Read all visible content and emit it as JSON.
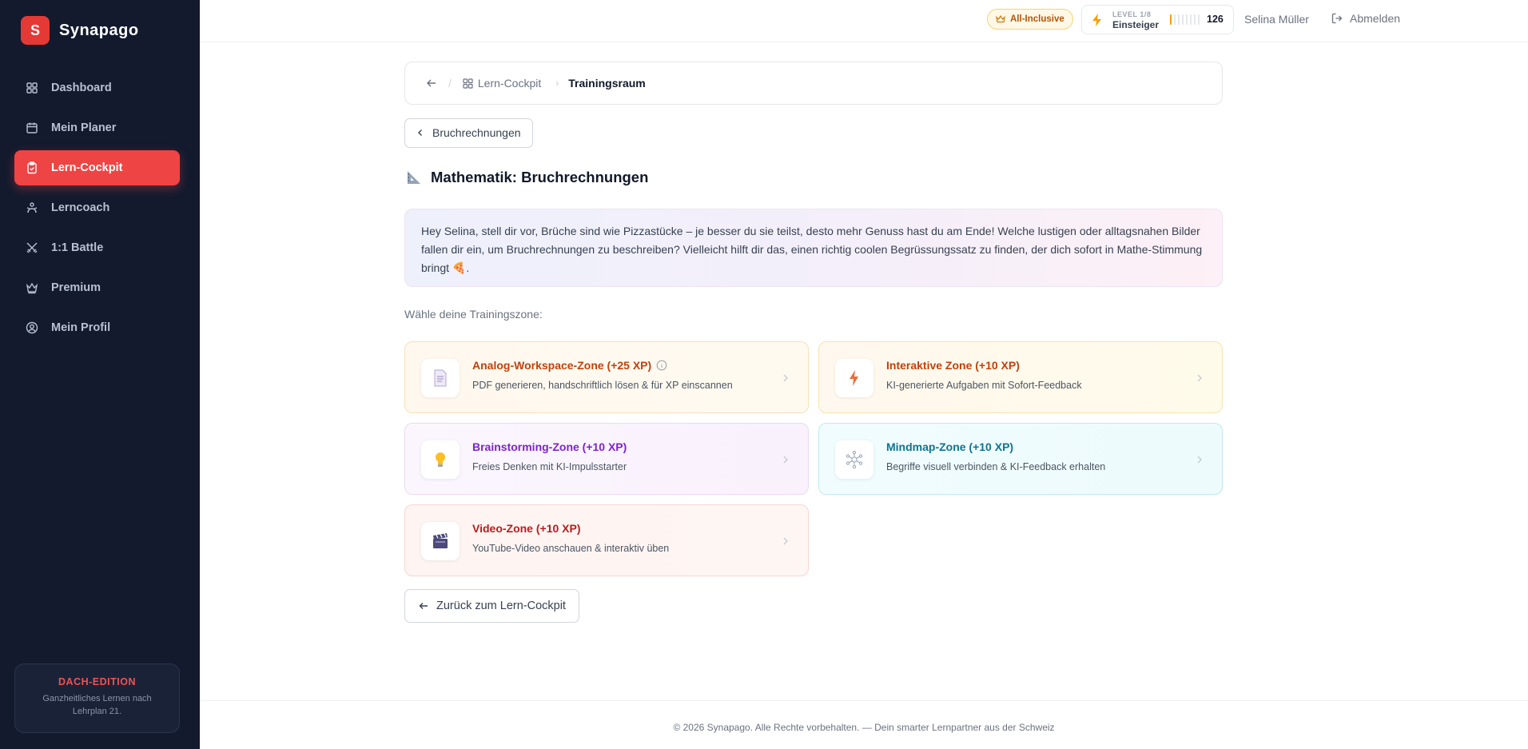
{
  "brand": {
    "logo_letter": "S",
    "name": "Synapago",
    "color": "#e53935"
  },
  "sidebar": {
    "items": [
      {
        "label": "Dashboard",
        "icon": "dashboard-icon",
        "active": false
      },
      {
        "label": "Mein Planer",
        "icon": "calendar-icon",
        "active": false
      },
      {
        "label": "Lern-Cockpit",
        "icon": "clipboard-icon",
        "active": true
      },
      {
        "label": "Lerncoach",
        "icon": "coach-icon",
        "active": false
      },
      {
        "label": "1:1 Battle",
        "icon": "swords-icon",
        "active": false
      },
      {
        "label": "Premium",
        "icon": "crown-icon",
        "active": false
      },
      {
        "label": "Mein Profil",
        "icon": "user-circle-icon",
        "active": false
      }
    ],
    "edition": {
      "title": "DACH-EDITION",
      "text": "Ganzheitliches Lernen nach Lehrplan 21."
    }
  },
  "header": {
    "plan_badge": "All-Inclusive",
    "level": {
      "label": "LEVEL 1/8",
      "name": "Einsteiger",
      "xp": "126",
      "progress_fraction": 0.125
    },
    "username": "Selina Müller",
    "logout": "Abmelden"
  },
  "breadcrumb": {
    "parent": "Lern-Cockpit",
    "current": "Trainingsraum"
  },
  "topic_button": "Bruchrechnungen",
  "page_title": "Mathematik: Bruchrechnungen",
  "intro": "Hey Selina, stell dir vor, Brüche sind wie Pizzastücke – je besser du sie teilst, desto mehr Genuss hast du am Ende! Welche lustigen oder alltagsnahen Bilder fallen dir ein, um Bruchrechnungen zu beschreiben? Vielleicht hilft dir das, einen richtig coolen Begrüssungssatz zu finden, der dich sofort in Mathe-Stimmung bringt 🍕.",
  "zone_label": "Wähle deine Trainingszone:",
  "zones": [
    {
      "title": "Analog-Workspace-Zone (+25 XP)",
      "desc": "PDF generieren, handschriftlich lösen & für XP einscannen",
      "icon": "document-icon",
      "color": "#c2410c",
      "has_info": true
    },
    {
      "title": "Interaktive Zone (+10 XP)",
      "desc": "KI-generierte Aufgaben mit Sofort-Feedback",
      "icon": "lightning-icon",
      "color": "#c2410c",
      "has_info": false
    },
    {
      "title": "Brainstorming-Zone (+10 XP)",
      "desc": "Freies Denken mit KI-Impulsstarter",
      "icon": "lightbulb-icon",
      "color": "#7e22ce",
      "has_info": false
    },
    {
      "title": "Mindmap-Zone (+10 XP)",
      "desc": "Begriffe visuell verbinden & KI-Feedback erhalten",
      "icon": "network-icon",
      "color": "#0e7490",
      "has_info": false
    },
    {
      "title": "Video-Zone (+10 XP)",
      "desc": "YouTube-Video anschauen & interaktiv üben",
      "icon": "clapperboard-icon",
      "color": "#b91c1c",
      "has_info": false
    }
  ],
  "back_button": "Zurück zum Lern-Cockpit",
  "footer": "© 2026 Synapago. Alle Rechte vorbehalten. — Dein smarter Lernpartner aus der Schweiz"
}
